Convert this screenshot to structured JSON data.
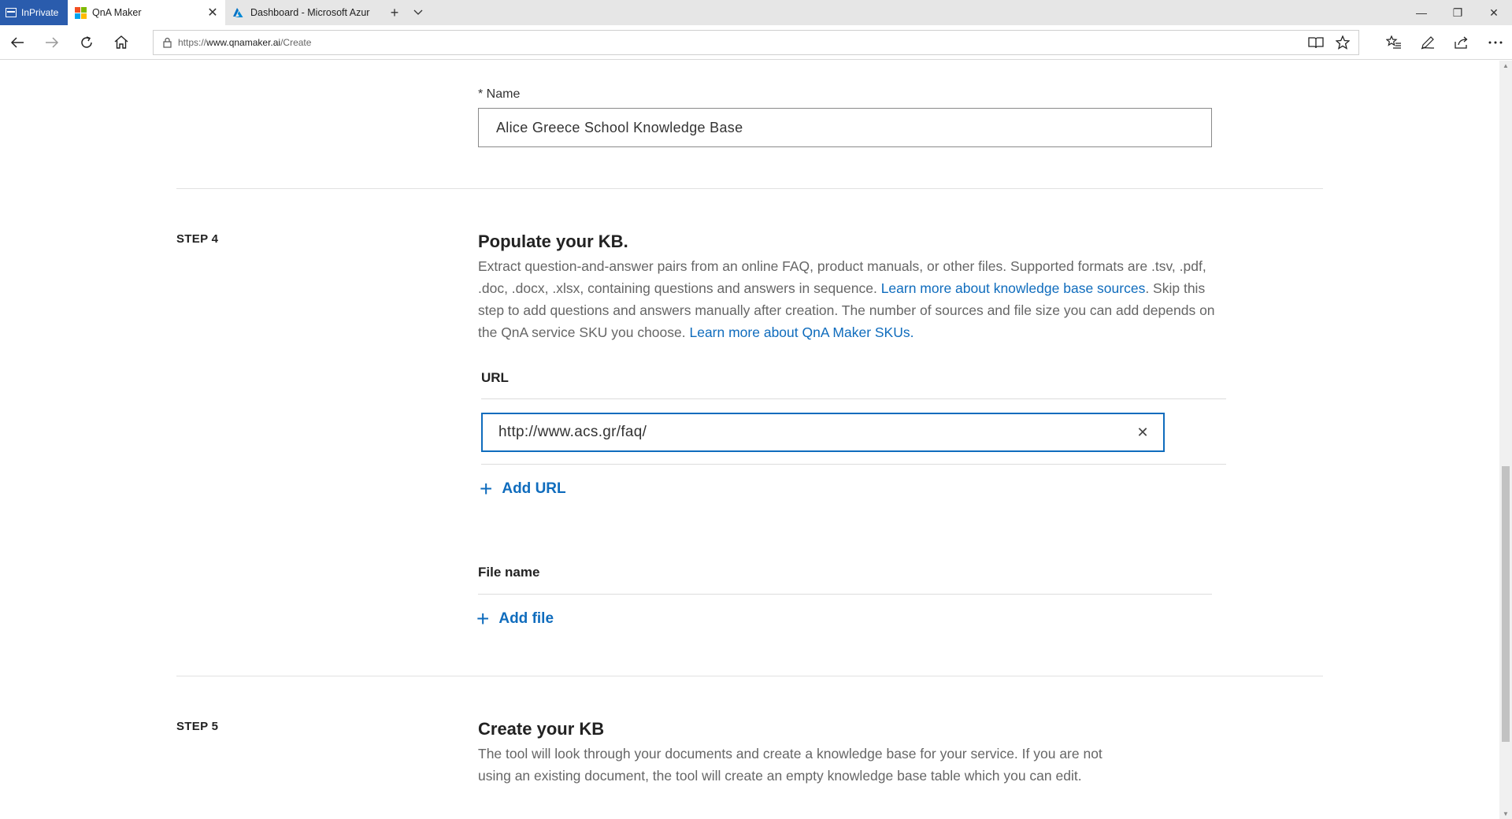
{
  "browser": {
    "inprivate_label": "InPrivate",
    "tabs": [
      {
        "title": "QnA Maker",
        "active": true
      },
      {
        "title": "Dashboard - Microsoft Azur",
        "active": false
      }
    ],
    "address": {
      "prefix": "https://",
      "host": "www.qnamaker.ai",
      "path": "/Create"
    }
  },
  "form": {
    "name_label": "* Name",
    "name_value": "Alice Greece School Knowledge Base"
  },
  "step4": {
    "step_label": "STEP 4",
    "title": "Populate your KB.",
    "desc_part1": "Extract question-and-answer pairs from an online FAQ, product manuals, or other files. Supported formats are .tsv, .pdf, .doc, .docx, .xlsx, containing questions and answers in sequence. ",
    "link1": "Learn more about knowledge base sources",
    "desc_part2": ". Skip this step to add questions and answers manually after creation. The number of sources and file size you can add depends on the QnA service SKU you choose. ",
    "link2": "Learn more about QnA Maker SKUs.",
    "url_heading": "URL",
    "url_value": "http://www.acs.gr/faq/",
    "add_url_label": "Add URL",
    "file_heading": "File name",
    "add_file_label": "Add file"
  },
  "step5": {
    "step_label": "STEP 5",
    "title": "Create your KB",
    "desc": "The tool will look through your documents and create a knowledge base for your service. If you are not using an existing document, the tool will create an empty knowledge base table which you can edit."
  }
}
